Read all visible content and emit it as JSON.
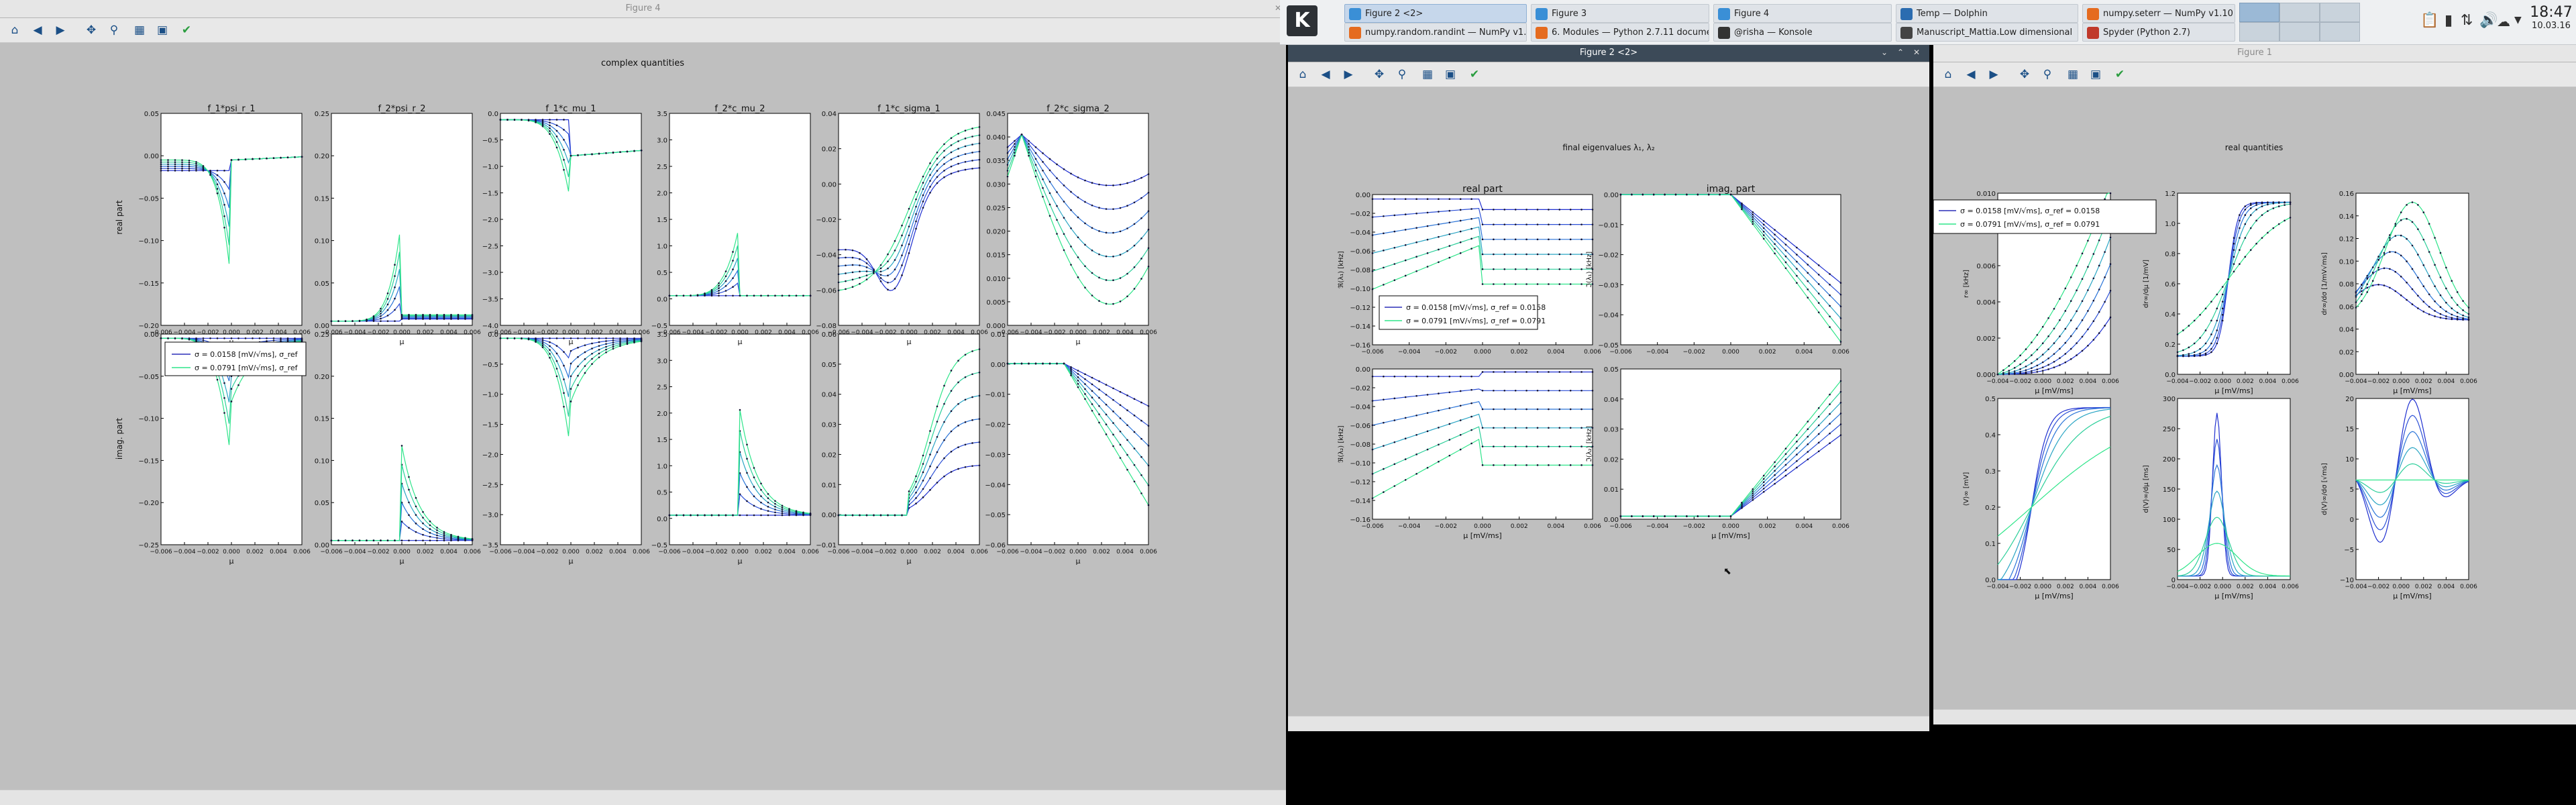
{
  "panel": {
    "launcher": "K",
    "clock_time": "18:47",
    "clock_date": "10.03.16",
    "tasks": [
      {
        "label": "Figure 2 <2>",
        "icon_color": "#3a8fd6",
        "active": true
      },
      {
        "label": "Figure 3",
        "icon_color": "#3a8fd6",
        "active": false
      },
      {
        "label": "Figure 4",
        "icon_color": "#3a8fd6",
        "active": false
      },
      {
        "label": "Temp — Dolphin",
        "icon_color": "#2b6cb0",
        "active": false
      },
      {
        "label": "numpy.seterr — NumPy v1.10 Manual - Mozilla Firefox",
        "icon_color": "#e56b1f",
        "active": false
      },
      {
        "label": "numpy.random.randint — NumPy v1.10 Manual - Mozilla Firefox",
        "icon_color": "#e56b1f",
        "active": false
      },
      {
        "label": "6. Modules — Python 2.7.11 documentation - Mozilla Firefox",
        "icon_color": "#e56b1f",
        "active": false
      },
      {
        "label": "@risha — Konsole",
        "icon_color": "#333333",
        "active": false
      },
      {
        "label": "Manuscript_Mattia.Low dimensional",
        "icon_color": "#444444",
        "active": false
      },
      {
        "label": "Spyder (Python 2.7)",
        "icon_color": "#c0392b",
        "active": false
      }
    ]
  },
  "toolbar_icons": [
    "home-icon",
    "back-icon",
    "forward-icon",
    "pan-icon",
    "zoom-icon",
    "configure-subplots-icon",
    "save-icon",
    "edit-axes-icon"
  ],
  "windows": {
    "left": {
      "title": "Figure 4",
      "suptitle": "complex quantities",
      "row_labels": [
        "real part",
        "imag. part"
      ],
      "x_label": "μ",
      "legend": [
        "σ = 0.0158 [mV/√ms], σ_ref",
        "σ = 0.0791 [mV/√ms], σ_ref"
      ],
      "x_ticks": [
        "−0.006",
        "−0.004",
        "−0.002",
        "0.000",
        "0.002",
        "0.004",
        "0.006"
      ],
      "panels": [
        {
          "title": "f_1*psi_r_1",
          "yticks_top": [
            "0.05",
            "0.00",
            "−0.05",
            "−0.10",
            "−0.15",
            "−0.20"
          ],
          "yticks_bot": [
            "0.00",
            "−0.05",
            "−0.10",
            "−0.15",
            "−0.20",
            "−0.25"
          ]
        },
        {
          "title": "f_2*psi_r_2",
          "yticks_top": [
            "0.25",
            "0.20",
            "0.15",
            "0.10",
            "0.05",
            "0.00"
          ],
          "yticks_bot": [
            "0.25",
            "0.20",
            "0.15",
            "0.10",
            "0.05",
            "0.00"
          ]
        },
        {
          "title": "f_1*c_mu_1",
          "yticks_top": [
            "0.0",
            "−0.5",
            "−1.0",
            "−1.5",
            "−2.0",
            "−2.5",
            "−3.0",
            "−3.5",
            "−4.0"
          ],
          "yticks_bot": [
            "0.0",
            "−0.5",
            "−1.0",
            "−1.5",
            "−2.0",
            "−2.5",
            "−3.0",
            "−3.5"
          ]
        },
        {
          "title": "f_2*c_mu_2",
          "yticks_top": [
            "3.5",
            "3.0",
            "2.5",
            "2.0",
            "1.5",
            "1.0",
            "0.5",
            "0.0",
            "−0.5"
          ],
          "yticks_bot": [
            "3.5",
            "3.0",
            "2.5",
            "2.0",
            "1.5",
            "1.0",
            "0.5",
            "0.0",
            "−0.5"
          ]
        },
        {
          "title": "f_1*c_sigma_1",
          "yticks_top": [
            "0.04",
            "0.02",
            "0.00",
            "−0.02",
            "−0.04",
            "−0.06",
            "−0.08"
          ],
          "yticks_bot": [
            "0.06",
            "0.05",
            "0.04",
            "0.03",
            "0.02",
            "0.01",
            "0.00",
            "−0.01"
          ]
        },
        {
          "title": "f_2*c_sigma_2",
          "yticks_top": [
            "0.045",
            "0.040",
            "0.035",
            "0.030",
            "0.025",
            "0.020",
            "0.015",
            "0.010",
            "0.005",
            "0.000"
          ],
          "yticks_bot": [
            "0.01",
            "0.00",
            "−0.01",
            "−0.02",
            "−0.03",
            "−0.04",
            "−0.05",
            "−0.06"
          ]
        }
      ]
    },
    "middle": {
      "title": "Figure 2 <2>",
      "suptitle": "final eigenvalues λ₁, λ₂",
      "col_titles": [
        "real part",
        "imag. part"
      ],
      "x_label": "μ [mV/ms]",
      "x_ticks": [
        "−0.006",
        "−0.004",
        "−0.002",
        "0.000",
        "0.002",
        "0.004",
        "0.006"
      ],
      "legend": [
        "σ = 0.0158 [mV/√ms], σ_ref = 0.0158",
        "σ = 0.0791 [mV/√ms], σ_ref = 0.0791"
      ],
      "ylabels": [
        "ℜ(λ₁) [kHz]",
        "ℑ(λ₁) [kHz]",
        "ℜ(λ₂) [kHz]",
        "ℑ(λ₂) [kHz]"
      ],
      "yticks": [
        [
          "0.00",
          "−0.02",
          "−0.04",
          "−0.06",
          "−0.08",
          "−0.10",
          "−0.12",
          "−0.14",
          "−0.16"
        ],
        [
          "0.00",
          "−0.01",
          "−0.02",
          "−0.03",
          "−0.04",
          "−0.05"
        ],
        [
          "0.00",
          "−0.02",
          "−0.04",
          "−0.06",
          "−0.08",
          "−0.10",
          "−0.12",
          "−0.14",
          "−0.16"
        ],
        [
          "0.05",
          "0.04",
          "0.03",
          "0.02",
          "0.01",
          "0.00"
        ]
      ]
    },
    "right": {
      "title": "Figure 1",
      "suptitle": "real quantities",
      "x_label": "μ [mV/ms]",
      "legend": [
        "σ = 0.0158 [mV/√ms], σ_ref = 0.0158",
        "σ = 0.0791 [mV/√ms], σ_ref = 0.0791"
      ],
      "x_ticks": [
        "−0.004",
        "−0.002",
        "0.000",
        "0.002",
        "0.004",
        "0.006"
      ],
      "ylabels": [
        "r∞ [kHz]",
        "dr∞/dμ [1/mV]",
        "dr∞/dσ [1/mV√ms]",
        "⟨V⟩∞ [mV]",
        "d⟨V⟩∞/dμ [ms]",
        "d⟨V⟩∞/dσ [√ms]"
      ],
      "yticks": [
        [
          "0.010",
          "0.008",
          "0.006",
          "0.004",
          "0.002",
          "0.000"
        ],
        [
          "1.2",
          "1.0",
          "0.8",
          "0.6",
          "0.4",
          "0.2",
          "0.0"
        ],
        [
          "0.16",
          "0.14",
          "0.12",
          "0.10",
          "0.08",
          "0.06",
          "0.04",
          "0.02",
          "0.00"
        ],
        [
          "0.5",
          "0.4",
          "0.3",
          "0.2",
          "0.1",
          "0.0"
        ],
        [
          "300",
          "250",
          "200",
          "150",
          "100",
          "50",
          "0"
        ],
        [
          "20",
          "15",
          "10",
          "5",
          "0",
          "−5",
          "−10"
        ]
      ]
    }
  }
}
